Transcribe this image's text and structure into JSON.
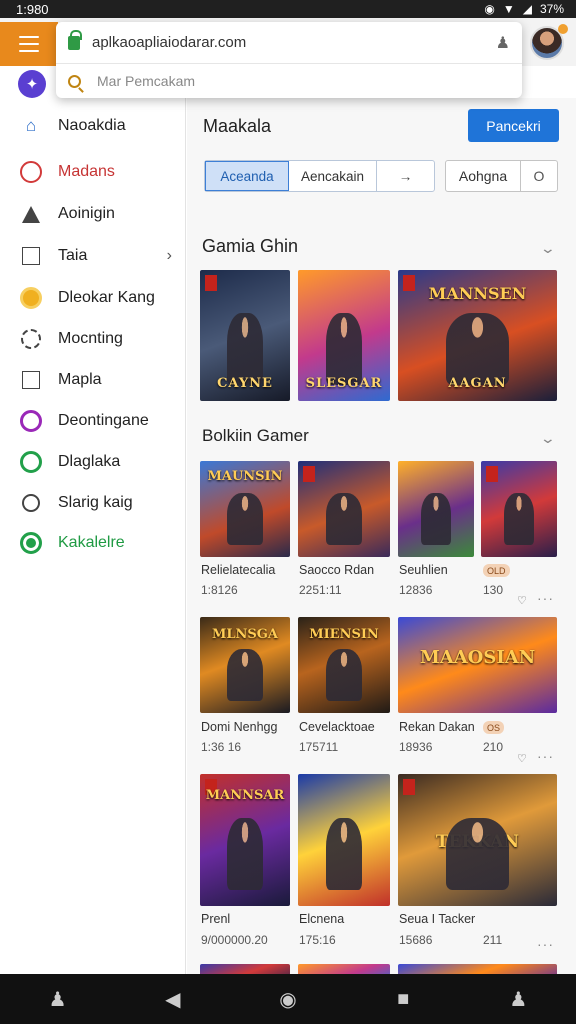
{
  "status": {
    "time": "1:980",
    "right_text": "37%"
  },
  "browser": {
    "url": "aplkaoapliaiodarar.com",
    "search_placeholder": "Mar Pemcakam"
  },
  "sidebar": {
    "items": [
      {
        "label": "Naoakdia",
        "icon": "home-icon"
      },
      {
        "label": "Madans",
        "icon": "circle-red-icon"
      },
      {
        "label": "Aoinigin",
        "icon": "triangle-icon"
      },
      {
        "label": "Taia",
        "icon": "square-icon"
      },
      {
        "label": "Dleokar Kang",
        "icon": "coin-icon"
      },
      {
        "label": "Mocnting",
        "icon": "gear-icon"
      },
      {
        "label": "Mapla",
        "icon": "map-icon"
      },
      {
        "label": "Deontingane",
        "icon": "purple-circle-icon"
      },
      {
        "label": "Dlaglaka",
        "icon": "green-circle-icon"
      },
      {
        "label": "Slarig kaig",
        "icon": "search-icon"
      },
      {
        "label": "Kakalelre",
        "icon": "green-ring-icon"
      }
    ],
    "colors": {
      "home": "#2f6fc9",
      "madans": "#d23a3a",
      "kakalelre": "#22a04a"
    }
  },
  "main": {
    "title": "Maakala",
    "primary_button": "Pancekri",
    "segments": [
      "Aceanda",
      "Aencakain",
      "→"
    ],
    "filter": {
      "label": "Aohgna",
      "button": "O"
    },
    "section1": {
      "title": "Gamia Ghin",
      "tiles": [
        {
          "caption": "CAYNE"
        },
        {
          "caption": "SLESGAR"
        },
        {
          "caption": "AAGAN",
          "top": "MANNSEN"
        }
      ]
    },
    "section2": {
      "title": "Bolkiin Gamer",
      "rows": [
        [
          {
            "name": "Relielatecalia",
            "value": "1:8126",
            "top": "MAUNSIN"
          },
          {
            "name": "Saocco Rdan",
            "value": "2251:11"
          },
          {
            "name": "Seuhlien",
            "value": "12836"
          },
          {
            "name": "",
            "value": "130",
            "badge": "OLD"
          }
        ],
        [
          {
            "name": "Domi Nenhgg",
            "value": "1:36 16",
            "top": "MLNSGA"
          },
          {
            "name": "Cevelacktoae",
            "value": "175711",
            "top": "MIENSIN"
          },
          {
            "name": "Rekan Dakan",
            "value": "18936",
            "badge": "OS",
            "top": "MAAOSIAN"
          },
          {
            "name": "",
            "value": "210"
          }
        ],
        [
          {
            "name": "Prenl",
            "value": "9/000000.20",
            "top": "MANNSAR"
          },
          {
            "name": "Elcnena",
            "value": "175:16"
          },
          {
            "name": "Seua I Tacker",
            "value": "15686",
            "top": "TEKKAN"
          },
          {
            "name": "",
            "value": "211"
          }
        ]
      ]
    }
  }
}
